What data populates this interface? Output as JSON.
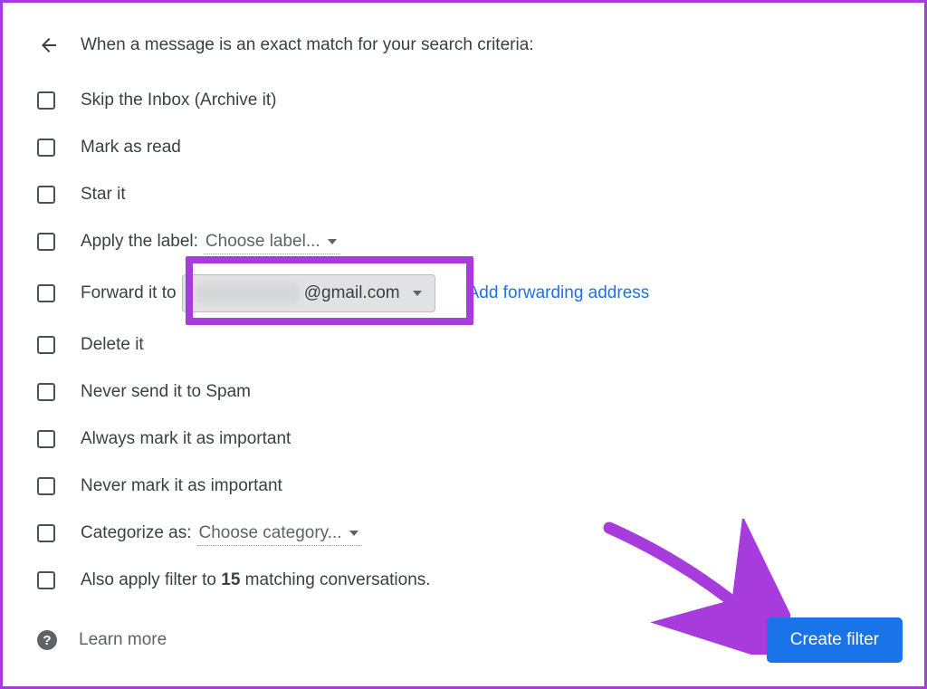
{
  "header": {
    "title": "When a message is an exact match for your search criteria:"
  },
  "options": {
    "skip_inbox": "Skip the Inbox (Archive it)",
    "mark_read": "Mark as read",
    "star_it": "Star it",
    "apply_label_prefix": "Apply the label:",
    "apply_label_choose": "Choose label...",
    "forward_prefix": "Forward it to",
    "forward_domain": "@gmail.com",
    "add_forward_link": "Add forwarding address",
    "delete_it": "Delete it",
    "never_spam": "Never send it to Spam",
    "always_important": "Always mark it as important",
    "never_important": "Never mark it as important",
    "categorize_prefix": "Categorize as:",
    "categorize_choose": "Choose category...",
    "also_apply_prefix": "Also apply filter to ",
    "also_apply_count": "15",
    "also_apply_suffix": " matching conversations."
  },
  "footer": {
    "learn_more": "Learn more",
    "create_filter": "Create filter"
  },
  "colors": {
    "accent": "#1a73e8",
    "highlight": "#a83bdb"
  }
}
